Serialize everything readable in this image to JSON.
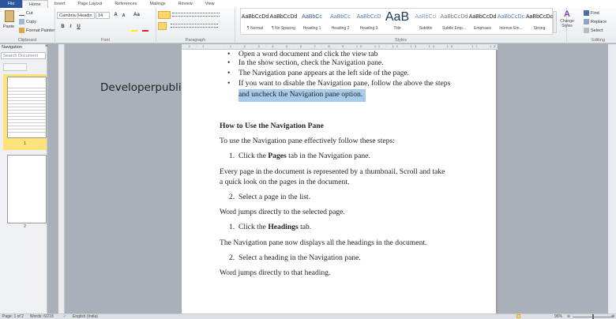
{
  "tabs": [
    "File",
    "Home",
    "Insert",
    "Page Layout",
    "References",
    "Mailings",
    "Review",
    "View"
  ],
  "clipboard": {
    "paste": "Paste",
    "cut": "Cut",
    "copy": "Copy",
    "format_painter": "Format Painter",
    "label": "Clipboard"
  },
  "font": {
    "name": "Cambria (Headin",
    "size": "14",
    "label": "Font",
    "bold": "B",
    "italic": "I",
    "underline": "U",
    "grow": "A",
    "shrink": "A",
    "case": "Aa"
  },
  "paragraph": {
    "label": "Paragraph"
  },
  "styles": {
    "label": "Styles",
    "items": [
      {
        "sample": "AaBbCcDd",
        "name": "¶ Normal",
        "color": "#222"
      },
      {
        "sample": "AaBbCcDd",
        "name": "¶ No Spacing",
        "color": "#222"
      },
      {
        "sample": "AaBbCc",
        "name": "Heading 1",
        "color": "#2e5b93"
      },
      {
        "sample": "AaBbCc",
        "name": "Heading 2",
        "color": "#4f81bd"
      },
      {
        "sample": "AaBbCcD",
        "name": "Heading 3",
        "color": "#4f81bd"
      },
      {
        "sample": "AaB",
        "name": "Title",
        "color": "#17365d"
      },
      {
        "sample": "AaBbCcl",
        "name": "Subtitle",
        "color": "#7f9fcf"
      },
      {
        "sample": "AaBbCcDd",
        "name": "Subtle Emp...",
        "color": "#777"
      },
      {
        "sample": "AaBbCcDd",
        "name": "Emphasis",
        "color": "#222"
      },
      {
        "sample": "AaBbCcDc",
        "name": "Intense Em...",
        "color": "#4f81bd"
      },
      {
        "sample": "AaBbCcDc",
        "name": "Strong",
        "color": "#111"
      }
    ],
    "change_styles": "Change Styles"
  },
  "editing": {
    "label": "Editing",
    "find": "Find",
    "replace": "Replace",
    "select": "Select"
  },
  "navigation": {
    "title": "Navigation",
    "search_placeholder": "Search Document",
    "pages": [
      "1",
      "2"
    ]
  },
  "ruler": "· 2 · 1 · · · 1 · 2 · 3 · 4 · 5 · 6 · 7 · 8 · 9 · 10 · 11 · 12 · 13 · 14 · 15 · · 17 · 18",
  "watermark": "Developerpublish.com",
  "document": {
    "bullets": [
      "Open a word document and click the view tab",
      "In the show section, check the Navigation pane.",
      "The Navigation pane appears at the left side of the page.",
      "If you want to disable the Navigation pane, follow the above the steps"
    ],
    "bullet_cont": "and uncheck the Navigation pane option.",
    "heading": "How to Use the Navigation Pane",
    "intro": "To use the Navigation pane effectively follow these steps:",
    "step1_pre": "Click the ",
    "step1_bold": "Pages",
    "step1_post": " tab in the Navigation pane.",
    "para1a": "Every page in the document is represented by a thumbnail. Scroll and take",
    "para1b": "a quick look on the pages in the document.",
    "step2": "Select a page in the list.",
    "para2": "Word jumps directly to the selected page.",
    "step3_pre": "Click the ",
    "step3_bold": "Headings",
    "step3_post": " tab.",
    "para3": "The Navigation pane now displays all the headings in the document.",
    "step4": "Select a heading in the Navigation pane.",
    "para4": "Word jumps directly to that heading.",
    "n1": "1.",
    "n2": "2."
  },
  "status": {
    "page": "Page: 1 of 2",
    "words": "Words: 6/218",
    "language": "English (India)",
    "zoom": "96%"
  }
}
